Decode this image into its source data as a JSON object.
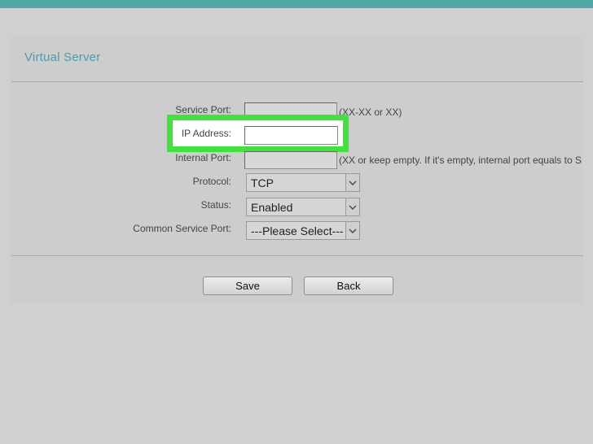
{
  "header": {
    "title": "Virtual Server"
  },
  "form": {
    "service_port": {
      "label": "Service Port:",
      "value": "",
      "hint": "(XX-XX or XX)"
    },
    "ip_address": {
      "label": "IP Address:",
      "value": ""
    },
    "internal_port": {
      "label": "Internal Port:",
      "value": "",
      "hint": "(XX or keep empty. If it's empty, internal port equals to S"
    },
    "protocol": {
      "label": "Protocol:",
      "selected": "TCP"
    },
    "status": {
      "label": "Status:",
      "selected": "Enabled"
    },
    "common_service_port": {
      "label": "Common Service Port:",
      "selected": "---Please Select---"
    }
  },
  "buttons": {
    "save": "Save",
    "back": "Back"
  },
  "colors": {
    "accent_bar": "#4ea7a4",
    "title": "#4a9dab",
    "highlight": "#3ee33b"
  },
  "icons": {
    "dropdown": "chevron-down-icon"
  }
}
